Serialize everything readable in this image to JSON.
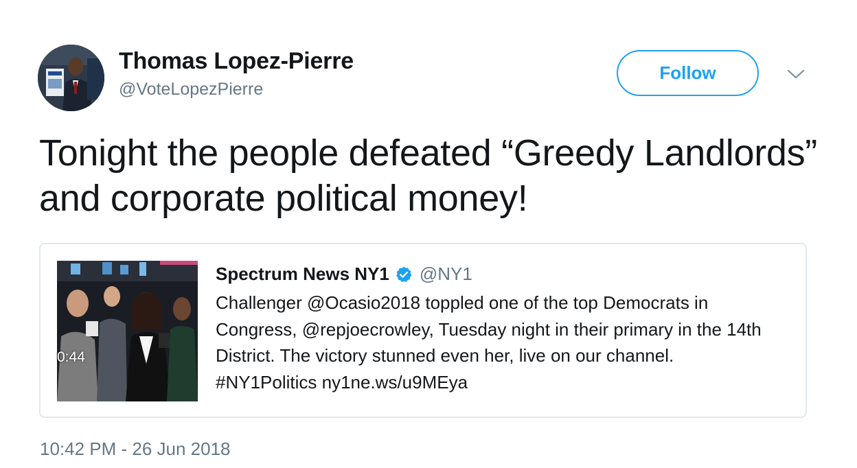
{
  "tweet": {
    "author": {
      "name": "Thomas Lopez-Pierre",
      "handle": "@VoteLopezPierre"
    },
    "follow_label": "Follow",
    "more_icon": "chevron-down-icon",
    "text": "Tonight the people defeated “Greedy Landlords” and corporate political money!",
    "timestamp": "10:42 PM - 26 Jun 2018"
  },
  "quoted_tweet": {
    "author_name": "Spectrum News NY1",
    "handle": "@NY1",
    "verified_icon": "verified-badge-icon",
    "text": "Challenger @Ocasio2018 toppled one of the top Democrats in Congress, @repjoecrowley, Tuesday night in their primary in the 14th District. The victory stunned even her, live on our channel. #NY1Politics ny1ne.ws/u9MEya",
    "video_duration": "0:44"
  },
  "colors": {
    "accent": "#1da1f2",
    "secondary_text": "#657786",
    "border": "#e1e8ed",
    "text": "#14171a"
  }
}
